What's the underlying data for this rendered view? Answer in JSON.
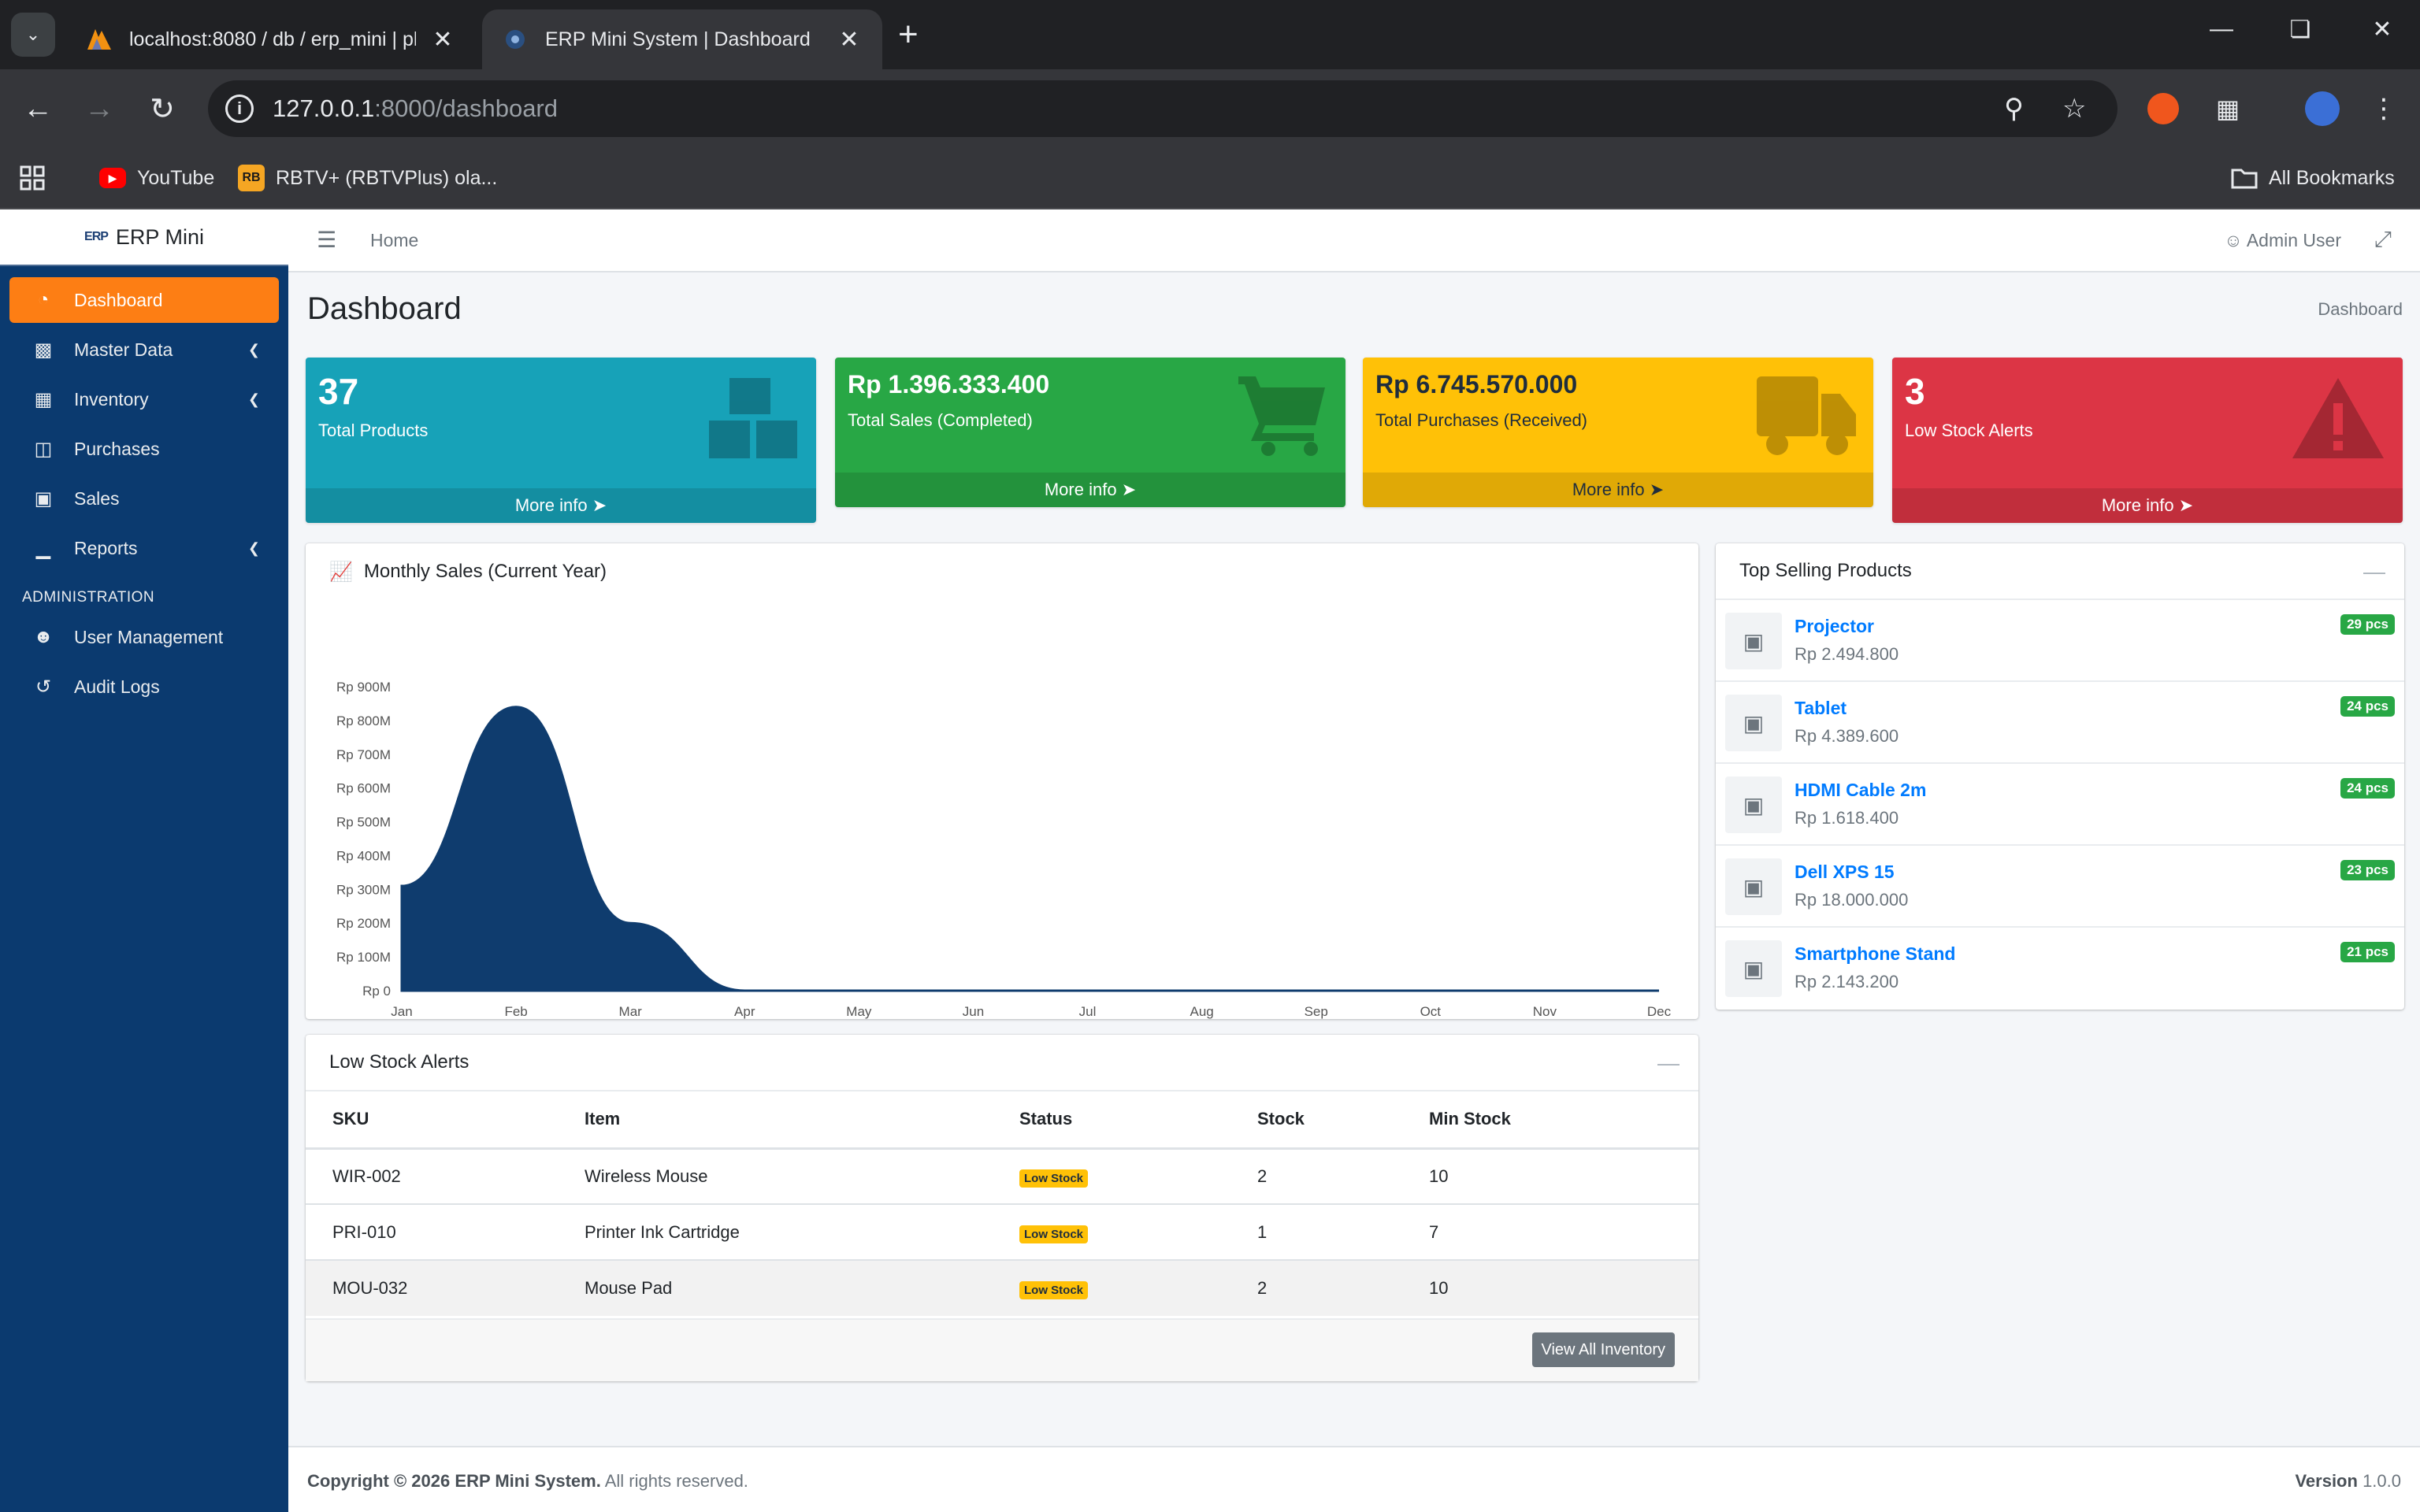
{
  "browser": {
    "tabs": [
      {
        "title": "localhost:8080 / db / erp_mini | ph"
      },
      {
        "title": "ERP Mini System | Dashboard"
      }
    ],
    "url_host": "127.0.0.1",
    "url_rest": ":8000/dashboard",
    "bookmarks": [
      {
        "label": "YouTube"
      },
      {
        "label": "RBTV+ (RBTVPlus) ola..."
      }
    ],
    "all_bookmarks": "All Bookmarks"
  },
  "app": {
    "brand": "ERP Mini",
    "brand_logo": "ERP",
    "header": {
      "home": "Home",
      "user": "Admin User"
    },
    "sidebar": {
      "items": [
        {
          "label": "Dashboard",
          "icon": "dashboard-gauge-icon"
        },
        {
          "label": "Master Data",
          "icon": "database-icon"
        },
        {
          "label": "Inventory",
          "icon": "boxes-icon"
        },
        {
          "label": "Purchases",
          "icon": "cart-icon"
        },
        {
          "label": "Sales",
          "icon": "truck-icon"
        },
        {
          "label": "Reports",
          "icon": "bar-chart-icon"
        }
      ],
      "admin_header": "ADMINISTRATION",
      "admin_items": [
        {
          "label": "User Management",
          "icon": "users-icon"
        },
        {
          "label": "Audit Logs",
          "icon": "history-icon"
        }
      ]
    },
    "page_title": "Dashboard",
    "breadcrumb": "Dashboard",
    "stats": [
      {
        "value": "37",
        "label": "Total Products",
        "more": "More info",
        "color": "#17a2b8"
      },
      {
        "value": "Rp 1.396.333.400",
        "label": "Total Sales (Completed)",
        "more": "More info",
        "color": "#28a745"
      },
      {
        "value": "Rp 6.745.570.000",
        "label": "Total Purchases (Received)",
        "more": "More info",
        "color": "#ffc107"
      },
      {
        "value": "3",
        "label": "Low Stock Alerts",
        "more": "More info",
        "color": "#dc3545"
      }
    ],
    "chart_title": "Monthly Sales (Current Year)",
    "top_selling": {
      "title": "Top Selling Products",
      "items": [
        {
          "name": "Projector",
          "price": "Rp 2.494.800",
          "qty": "29 pcs"
        },
        {
          "name": "Tablet",
          "price": "Rp 4.389.600",
          "qty": "24 pcs"
        },
        {
          "name": "HDMI Cable 2m",
          "price": "Rp 1.618.400",
          "qty": "24 pcs"
        },
        {
          "name": "Dell XPS 15",
          "price": "Rp 18.000.000",
          "qty": "23 pcs"
        },
        {
          "name": "Smartphone Stand",
          "price": "Rp 2.143.200",
          "qty": "21 pcs"
        }
      ]
    },
    "low_stock": {
      "title": "Low Stock Alerts",
      "columns": [
        "SKU",
        "Item",
        "Status",
        "Stock",
        "Min Stock"
      ],
      "rows": [
        {
          "sku": "WIR-002",
          "item": "Wireless Mouse",
          "status": "Low Stock",
          "stock": "2",
          "min": "10"
        },
        {
          "sku": "PRI-010",
          "item": "Printer Ink Cartridge",
          "status": "Low Stock",
          "stock": "1",
          "min": "7"
        },
        {
          "sku": "MOU-032",
          "item": "Mouse Pad",
          "status": "Low Stock",
          "stock": "2",
          "min": "10"
        }
      ],
      "button": "View All Inventory"
    },
    "footer": {
      "copyright_prefix": "Copyright © 2026",
      "copyright_brand": "ERP Mini System.",
      "copyright_suffix": "All rights reserved.",
      "version_label": "Version",
      "version": "1.0.0"
    }
  },
  "chart_data": {
    "type": "area",
    "categories": [
      "Jan",
      "Feb",
      "Mar",
      "Apr",
      "May",
      "Jun",
      "Jul",
      "Aug",
      "Sep",
      "Oct",
      "Nov",
      "Dec"
    ],
    "values": [
      310000000,
      840000000,
      200000000,
      0,
      0,
      0,
      0,
      0,
      0,
      0,
      0,
      0
    ],
    "yticks": [
      "Rp 0",
      "Rp 100M",
      "Rp 200M",
      "Rp 300M",
      "Rp 400M",
      "Rp 500M",
      "Rp 600M",
      "Rp 700M",
      "Rp 800M",
      "Rp 900M"
    ],
    "ylim": [
      0,
      900000000
    ],
    "color": "#0f3c6e",
    "grid": false
  }
}
